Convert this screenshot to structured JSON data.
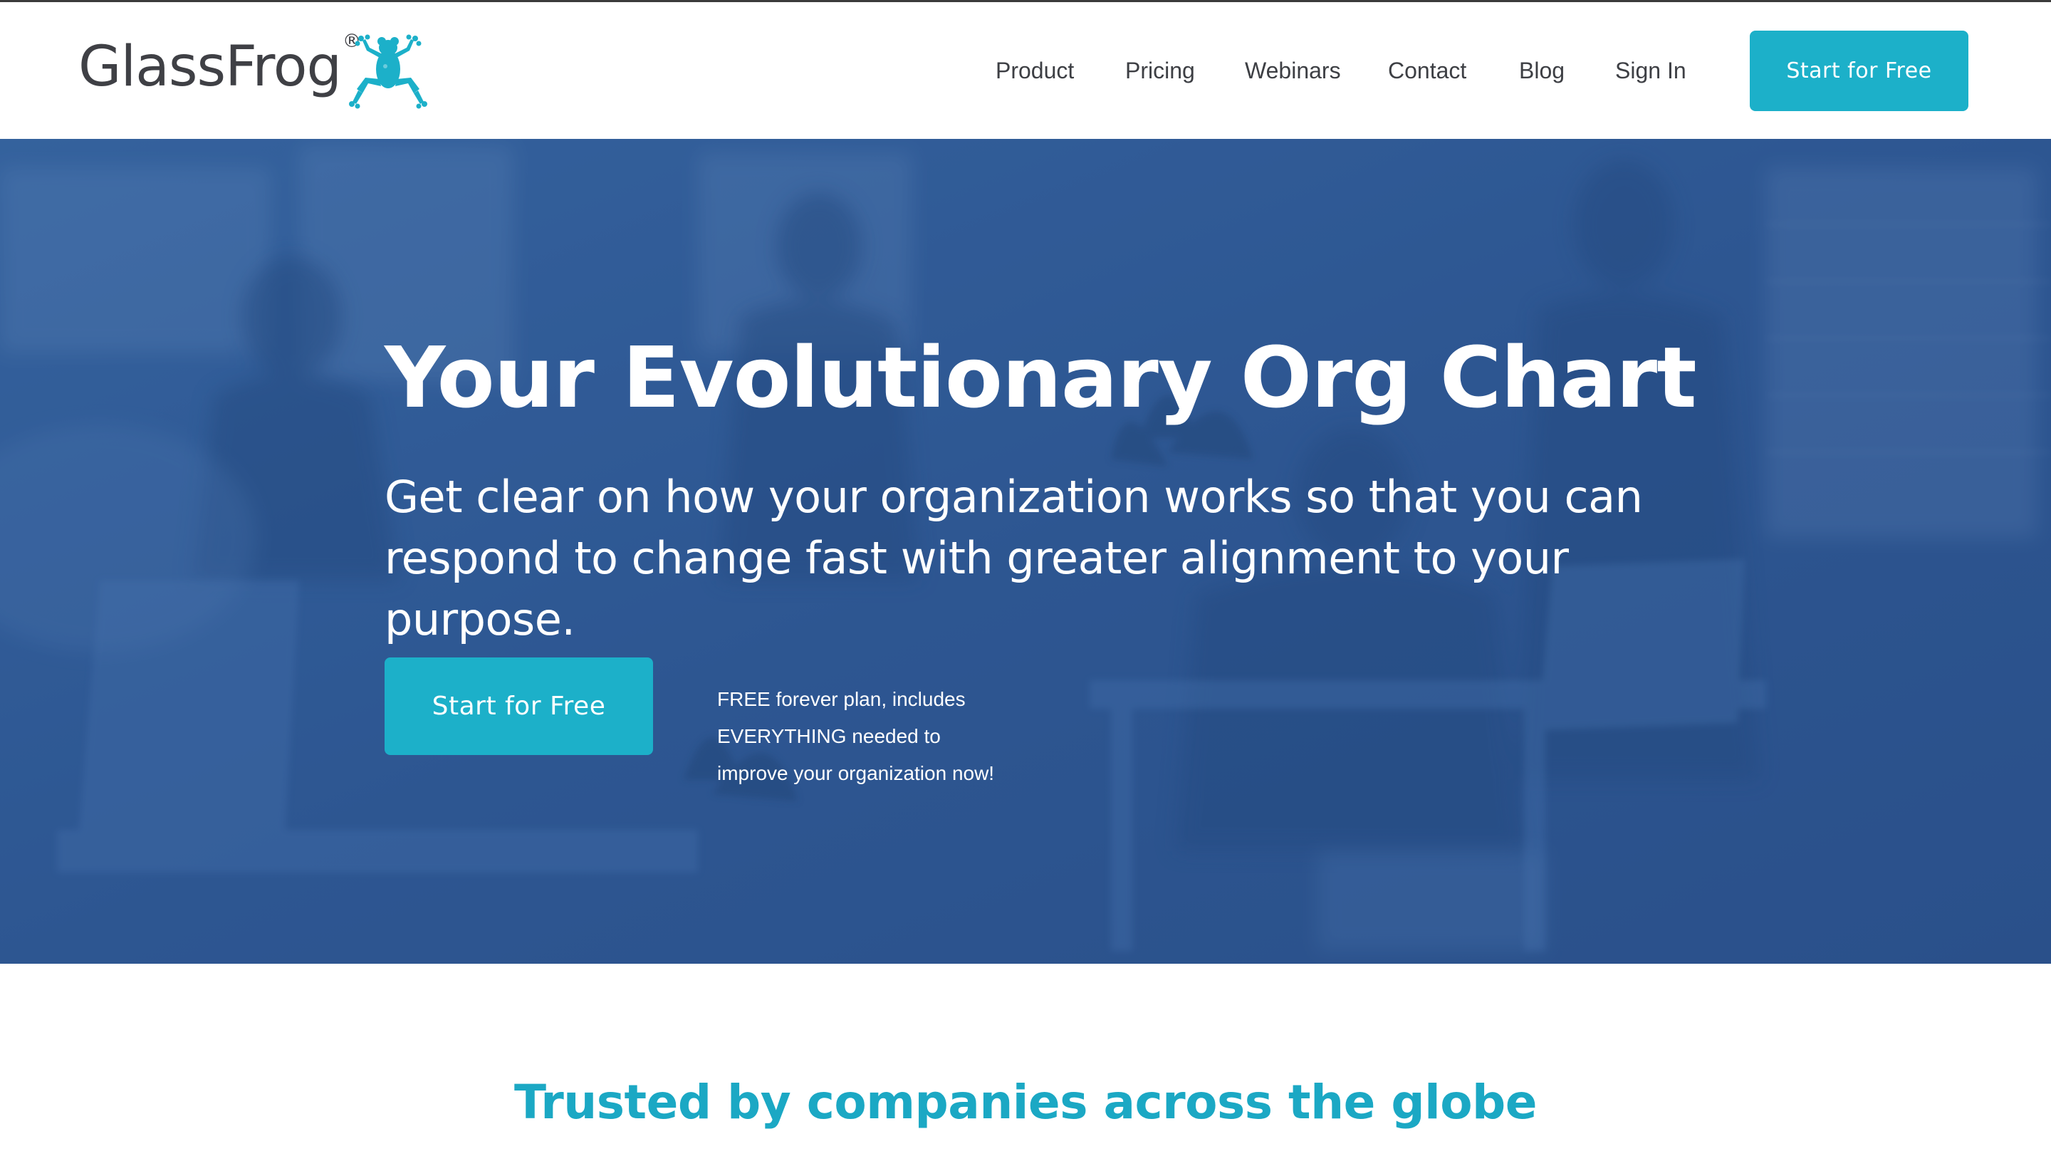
{
  "brand": {
    "name": "GlassFrog",
    "registered_mark": "®",
    "logo_icon": "frog-icon",
    "accent_color": "#1cb0c9",
    "text_color": "#3f4045"
  },
  "nav": {
    "items": [
      {
        "label": "Product"
      },
      {
        "label": "Pricing"
      },
      {
        "label": "Webinars"
      },
      {
        "label": "Contact"
      },
      {
        "label": "Blog"
      },
      {
        "label": "Sign In"
      }
    ],
    "cta_label": "Start for Free"
  },
  "hero": {
    "title": "Your Evolutionary Org Chart",
    "subtitle": "Get clear on how your organization works so that you can respond to change fast with greater alignment to your purpose.",
    "cta_label": "Start for Free",
    "note": "FREE forever plan, includes EVERYTHING needed to improve your organization now!",
    "overlay_color": "#2e5590"
  },
  "trusted": {
    "title": "Trusted by companies across the globe",
    "title_color": "#1ba8c4"
  }
}
